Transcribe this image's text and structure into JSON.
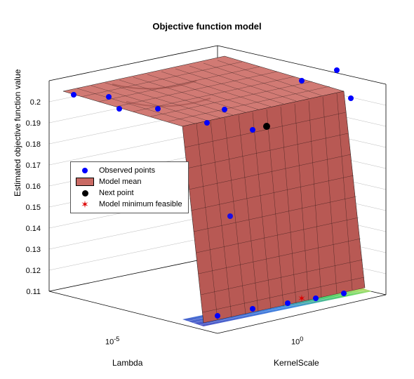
{
  "chart_data": {
    "type": "surface3d",
    "title": "Objective function model",
    "xlabel": "Lambda",
    "ylabel": "KernelScale",
    "zlabel": "Estimated objective function value",
    "x_axis_scale": "log",
    "y_axis_scale": "log",
    "x_ticks": [
      "10^-5"
    ],
    "y_ticks": [
      "10^0"
    ],
    "z_ticks": [
      0.11,
      0.12,
      0.13,
      0.14,
      0.15,
      0.16,
      0.17,
      0.18,
      0.19,
      0.2
    ],
    "zlim": [
      0.11,
      0.2
    ],
    "legend": {
      "entries": [
        {
          "label": "Observed points",
          "marker": "blue-dot"
        },
        {
          "label": "Model mean",
          "marker": "red-patch"
        },
        {
          "label": "Next point",
          "marker": "black-dot"
        },
        {
          "label": "Model minimum feasible",
          "marker": "red-star"
        }
      ],
      "position": "middle-left"
    },
    "observed_points_approx": [
      {
        "lambda": 1e-07,
        "kernel_scale": 0.01,
        "z": 0.198
      },
      {
        "lambda": 1e-06,
        "kernel_scale": 0.01,
        "z": 0.197
      },
      {
        "lambda": 1e-05,
        "kernel_scale": 0.01,
        "z": 0.196
      },
      {
        "lambda": 1e-05,
        "kernel_scale": 0.05,
        "z": 0.195
      },
      {
        "lambda": 0.0001,
        "kernel_scale": 0.05,
        "z": 0.196
      },
      {
        "lambda": 0.001,
        "kernel_scale": 0.2,
        "z": 0.185
      },
      {
        "lambda": 0.001,
        "kernel_scale": 1,
        "z": 0.182
      },
      {
        "lambda": 0.01,
        "kernel_scale": 5,
        "z": 0.2
      },
      {
        "lambda": 0.01,
        "kernel_scale": 30,
        "z": 0.198
      },
      {
        "lambda": 1e-06,
        "kernel_scale": 30,
        "z": 0.2
      },
      {
        "lambda": 0.0001,
        "kernel_scale": 30,
        "z": 0.199
      },
      {
        "lambda": 1e-07,
        "kernel_scale": 1,
        "z": 0.115
      },
      {
        "lambda": 1e-06,
        "kernel_scale": 1,
        "z": 0.114
      },
      {
        "lambda": 1e-05,
        "kernel_scale": 2,
        "z": 0.112
      },
      {
        "lambda": 0.0001,
        "kernel_scale": 3,
        "z": 0.111
      },
      {
        "lambda": 0.001,
        "kernel_scale": 3,
        "z": 0.113
      }
    ],
    "next_point_approx": {
      "lambda": 0.001,
      "kernel_scale": 0.5,
      "z": 0.183
    },
    "model_minimum_feasible_approx": {
      "lambda": 0.0001,
      "kernel_scale": 3,
      "z": 0.111
    },
    "surface_description": "Model mean surface is a plateau near z≈0.195–0.20 for small KernelScale across all Lambda, then drops steeply (cliff) to z≈0.11 as KernelScale increases toward 10^0."
  }
}
